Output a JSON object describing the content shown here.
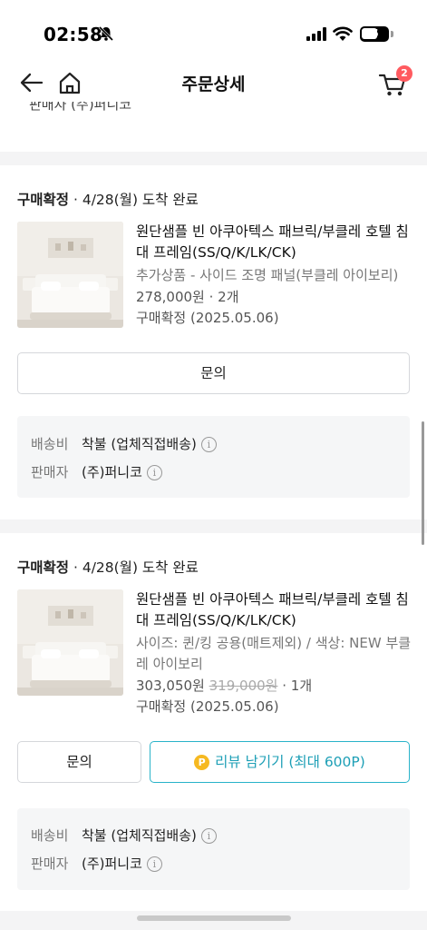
{
  "status_bar": {
    "time": "02:58",
    "battery": "55"
  },
  "header": {
    "title": "주문상세",
    "cart_count": "2"
  },
  "partial_top": {
    "seller_partial": "판매자  (주)퍼니코"
  },
  "orders": [
    {
      "status_bold": "구매확정",
      "status_text": " · 4/28(월) 도착 완료",
      "product_name": "원단샘플 빈 아쿠아텍스 패브릭/부클레 호텔 침대 프레임(SS/Q/K/LK/CK)",
      "option": "추가상품 - 사이드 조명 패널(부클레 아이보리)",
      "price": "278,000원",
      "original_price": "",
      "quantity": " · 2개",
      "confirm": "구매확정 (2025.05.06)",
      "inquiry_label": "문의",
      "shipping_label": "배송비",
      "shipping_value": "착불 (업체직접배송)",
      "seller_label": "판매자",
      "seller_value": "(주)퍼니코"
    },
    {
      "status_bold": "구매확정",
      "status_text": " · 4/28(월) 도착 완료",
      "product_name": "원단샘플 빈 아쿠아텍스 패브릭/부클레 호텔 침대 프레임(SS/Q/K/LK/CK)",
      "option": "사이즈: 퀸/킹 공용(매트제외) / 색상: NEW 부클레 아이보리",
      "price": "303,050원",
      "original_price": "319,000원",
      "quantity": " · 1개",
      "confirm": "구매확정 (2025.05.06)",
      "inquiry_label": "문의",
      "review_label": "리뷰 남기기 (최대 600P)",
      "shipping_label": "배송비",
      "shipping_value": "착불 (업체직접배송)",
      "seller_label": "판매자",
      "seller_value": "(주)퍼니코"
    }
  ],
  "icons": {
    "coin_glyph": "P",
    "info_glyph": "i"
  },
  "colors": {
    "accent": "#29b3c9",
    "badge": "#ff5a5f",
    "coin": "#f6b921"
  }
}
